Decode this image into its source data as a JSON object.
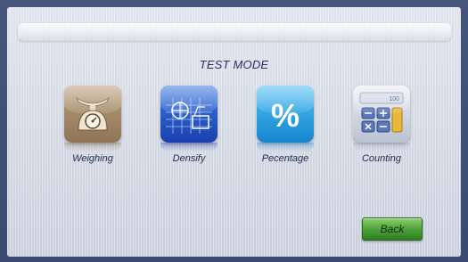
{
  "screen": {
    "title": "TEST MODE"
  },
  "modes": [
    {
      "label": "Weighing",
      "icon": "scale-icon"
    },
    {
      "label": "Densify",
      "icon": "density-icon"
    },
    {
      "label": "Pecentage",
      "icon": "percent-icon"
    },
    {
      "label": "Counting",
      "icon": "calculator-icon"
    }
  ],
  "percent_symbol": "%",
  "calculator_display": "100",
  "back_button": {
    "label": "Back",
    "color": "#4ca33a"
  }
}
